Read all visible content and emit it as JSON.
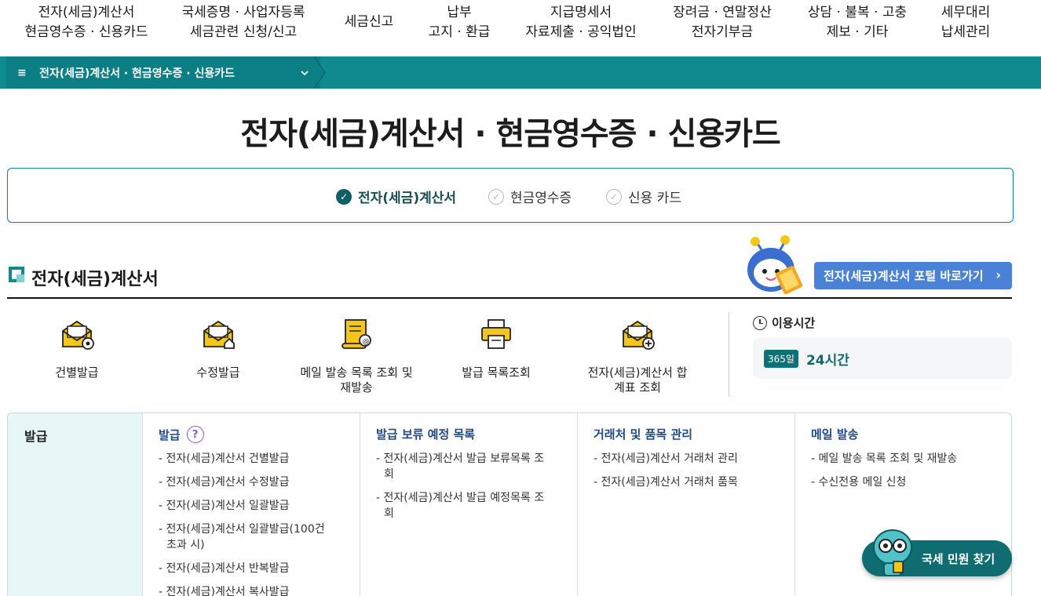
{
  "topnav": [
    {
      "line1": "전자(세금)계산서",
      "line2": "현금영수증 · 신용카드"
    },
    {
      "line1": "국세증명 · 사업자등록",
      "line2": "세금관련 신청/신고"
    },
    {
      "line1": "세금신고",
      "line2": ""
    },
    {
      "line1": "납부",
      "line2": "고지 · 환급"
    },
    {
      "line1": "지급명세서",
      "line2": "자료제출 · 공익법인"
    },
    {
      "line1": "장려금 · 연말정산",
      "line2": "전자기부금"
    },
    {
      "line1": "상담 · 불복 · 고충",
      "line2": "제보 · 기타"
    },
    {
      "line1": "세무대리",
      "line2": "납세관리"
    }
  ],
  "breadcrumb": {
    "menu_icon": "≡",
    "label": "전자(세금)계산서 · 현금영수증 · 신용카드"
  },
  "page_title": "전자(세금)계산서 · 현금영수증 · 신용카드",
  "tabs": [
    {
      "label": "전자(세금)계산서",
      "active": true
    },
    {
      "label": "현금영수증",
      "active": false
    },
    {
      "label": "신용 카드",
      "active": false
    }
  ],
  "section": {
    "title": "전자(세금)계산서",
    "portal_button": "전자(세금)계산서 포털 바로가기"
  },
  "quick": [
    {
      "label": "건별발급",
      "icon": "envelope-gear-icon"
    },
    {
      "label": "수정발급",
      "icon": "envelope-house-icon"
    },
    {
      "label": "메일 발송 목록 조회 및 재발송",
      "icon": "scroll-mail-icon"
    },
    {
      "label": "발급 목록조회",
      "icon": "printer-icon"
    },
    {
      "label": "전자(세금)계산서 합계표 조회",
      "icon": "envelope-plus-icon"
    }
  ],
  "time": {
    "title": "이용시간",
    "badge": "365일",
    "hours": "24시간"
  },
  "table": {
    "head": "발급",
    "cols": [
      {
        "title": "발급",
        "help": "?",
        "items": [
          "- 전자(세금)계산서 건별발급",
          "- 전자(세금)계산서 수정발급",
          "- 전자(세금)계산서 일괄발급",
          "- 전자(세금)계산서 일괄발급(100건 초과 시)",
          "- 전자(세금)계산서 반복발급",
          "- 전자(세금)계산서 복사발급"
        ]
      },
      {
        "title": "발급 보류 예정 목록",
        "items": [
          "- 전자(세금)계산서 발급 보류목록 조회",
          "- 전자(세금)계산서 발급 예정목록 조회"
        ]
      },
      {
        "title": "거래처 및 품목 관리",
        "items": [
          "- 전자(세금)계산서 거래처 관리",
          "- 전자(세금)계산서 거래처 품목"
        ]
      },
      {
        "title": "메일 발송",
        "items": [
          "- 메일 발송 목록 조회 및 재발송",
          "- 수신전용 메일 신청"
        ]
      }
    ]
  },
  "float_button": "국세 민원 찾기",
  "colors": {
    "teal": "#0f8a8f",
    "portal_blue": "#4a82d8",
    "icon_yellow": "#f5c518"
  }
}
